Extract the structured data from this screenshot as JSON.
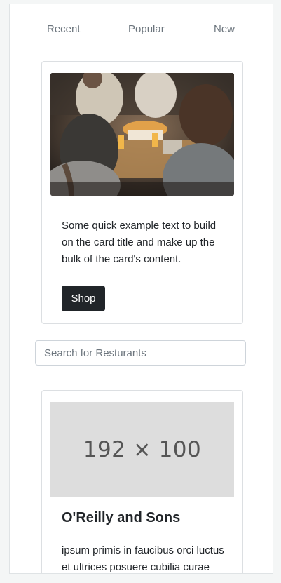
{
  "tabs": [
    {
      "label": "Recent"
    },
    {
      "label": "Popular"
    },
    {
      "label": "New"
    }
  ],
  "feature_card": {
    "text": "Some quick example text to build on the card title and make up the bulk of the card's content.",
    "button_label": "Shop"
  },
  "search": {
    "placeholder": "Search for Resturants"
  },
  "restaurant_card": {
    "image_placeholder": "192 × 100",
    "title": "O'Reilly and Sons",
    "description": "ipsum primis in faucibus orci luctus et ultrices posuere cubilia curae nulla dapibus dolor vel est"
  }
}
